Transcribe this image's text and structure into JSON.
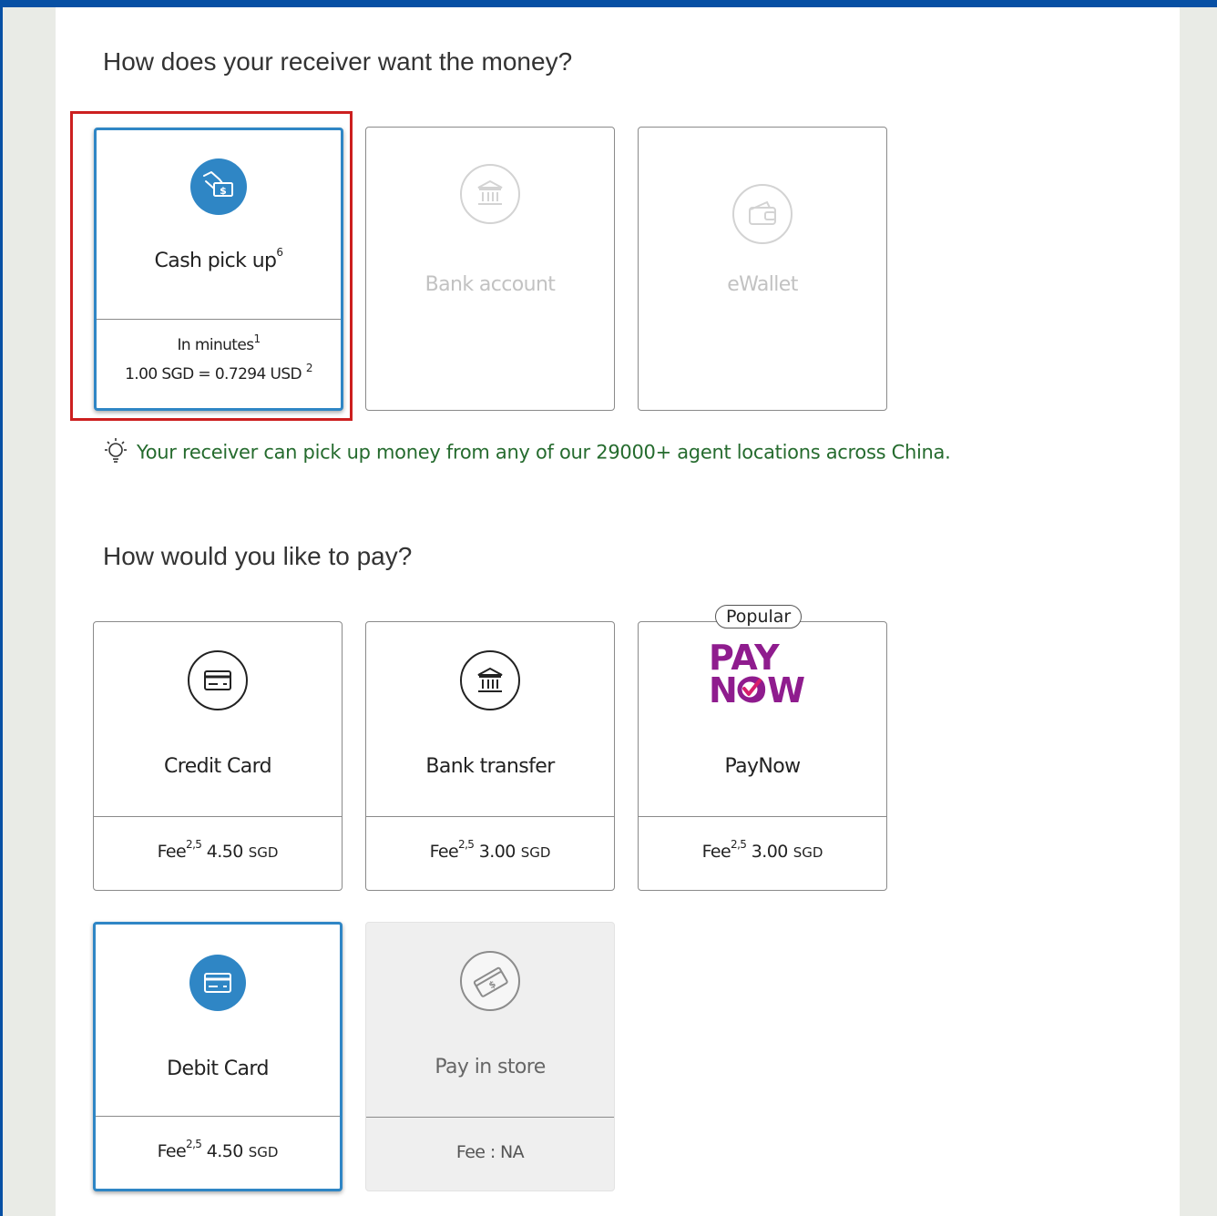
{
  "receive_section": {
    "heading": "How does your receiver want the money?",
    "options": [
      {
        "label": "Cash pick up",
        "label_sup": "6",
        "speed": "In minutes",
        "speed_sup": "1",
        "rate": "1.00 SGD = 0.7294 USD",
        "rate_sup": "2",
        "icon": "cash-hand-icon",
        "selected": true
      },
      {
        "label": "Bank account",
        "icon": "bank-icon",
        "disabled": true
      },
      {
        "label": "eWallet",
        "icon": "wallet-icon",
        "disabled": true
      }
    ],
    "tip": "Your receiver can pick up money from any of our 29000+ agent locations across China."
  },
  "pay_section": {
    "heading": "How would you like to pay?",
    "fee_label": "Fee",
    "fee_sup": "2,5",
    "options": [
      {
        "label": "Credit Card",
        "fee": "4.50",
        "currency": "SGD",
        "icon": "credit-card-icon"
      },
      {
        "label": "Bank transfer",
        "fee": "3.00",
        "currency": "SGD",
        "icon": "bank-icon"
      },
      {
        "label": "PayNow",
        "fee": "3.00",
        "currency": "SGD",
        "icon": "paynow-logo",
        "badge": "Popular",
        "logo_line1": "PAY",
        "logo_line2": "NOW"
      },
      {
        "label": "Debit Card",
        "fee": "4.50",
        "currency": "SGD",
        "icon": "debit-card-icon",
        "selected": true
      },
      {
        "label": "Pay in store",
        "fee_text": "Fee : NA",
        "icon": "cash-stack-icon",
        "disabled": true
      }
    ]
  },
  "colors": {
    "accent": "#2f86c5",
    "selection_outline": "#cc1f1f",
    "tip_text": "#256b2e",
    "paynow_purple": "#8f1c8e"
  }
}
